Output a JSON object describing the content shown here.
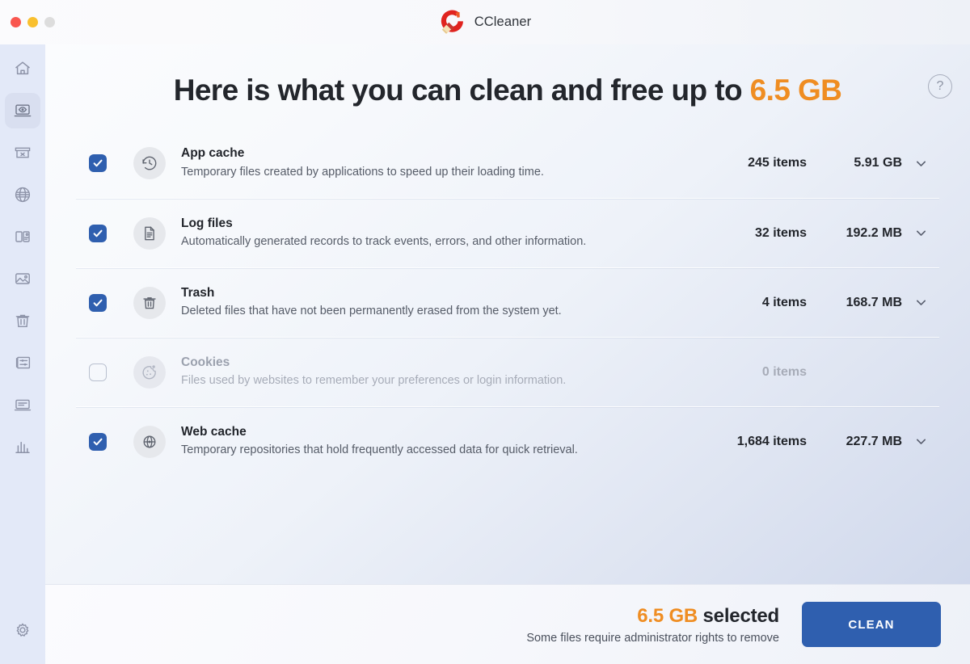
{
  "window": {
    "app_title": "CCleaner",
    "traffic_lights": [
      "close",
      "minimize",
      "maximize"
    ]
  },
  "sidebar": {
    "items": [
      {
        "label": "Home",
        "icon": "home-icon",
        "active": false
      },
      {
        "label": "Health Check",
        "icon": "laptop-eye-icon",
        "active": true
      },
      {
        "label": "Custom Clean",
        "icon": "box-x-icon",
        "active": false
      },
      {
        "label": "Browser Cleaner",
        "icon": "globe-icon",
        "active": false
      },
      {
        "label": "App Manager",
        "icon": "app-panels-icon",
        "active": false
      },
      {
        "label": "Duplicate Finder",
        "icon": "image-icon",
        "active": false
      },
      {
        "label": "Uninstaller",
        "icon": "trash-icon",
        "active": false
      },
      {
        "label": "File Manager",
        "icon": "files-slider-icon",
        "active": false
      },
      {
        "label": "Updater",
        "icon": "laptop-list-icon",
        "active": false
      },
      {
        "label": "Performance",
        "icon": "bar-chart-icon",
        "active": false
      }
    ],
    "settings": {
      "label": "Settings",
      "icon": "gear-icon"
    }
  },
  "header": {
    "headline_prefix": "Here is what you can clean and free up to ",
    "headline_amount": "6.5 GB",
    "help_icon": "question-circle-icon",
    "help_label": "?"
  },
  "rows": [
    {
      "title": "App cache",
      "description": "Temporary files created by applications to speed up their loading time.",
      "items": "245 items",
      "size": "5.91 GB",
      "checked": true,
      "enabled": true,
      "icon": "history-clock-icon",
      "chevron": "chevron-down-icon"
    },
    {
      "title": "Log files",
      "description": "Automatically generated records to track events, errors, and other information.",
      "items": "32 items",
      "size": "192.2 MB",
      "checked": true,
      "enabled": true,
      "icon": "document-icon",
      "chevron": "chevron-down-icon"
    },
    {
      "title": "Trash",
      "description": "Deleted files that have not been permanently erased from the system yet.",
      "items": "4 items",
      "size": "168.7 MB",
      "checked": true,
      "enabled": true,
      "icon": "trash-can-icon",
      "chevron": "chevron-down-icon"
    },
    {
      "title": "Cookies",
      "description": "Files used by websites to remember your preferences or login information.",
      "items": "0 items",
      "size": "",
      "checked": false,
      "enabled": false,
      "icon": "cookie-icon",
      "chevron": ""
    },
    {
      "title": "Web cache",
      "description": "Temporary repositories that hold frequently accessed data for quick retrieval.",
      "items": "1,684 items",
      "size": "227.7 MB",
      "checked": true,
      "enabled": true,
      "icon": "web-globe-icon",
      "chevron": "chevron-down-icon"
    }
  ],
  "footer": {
    "selected_amount": "6.5 GB",
    "selected_suffix": " selected",
    "note": "Some files require administrator rights to remove",
    "clean_button": "CLEAN"
  },
  "colors": {
    "accent_orange": "#ef8d22",
    "accent_blue": "#2f5faf",
    "sidebar_bg": "#e3e9f8",
    "text_primary": "#22252b",
    "text_muted": "#565c68",
    "disabled_text": "#a7acb8"
  }
}
